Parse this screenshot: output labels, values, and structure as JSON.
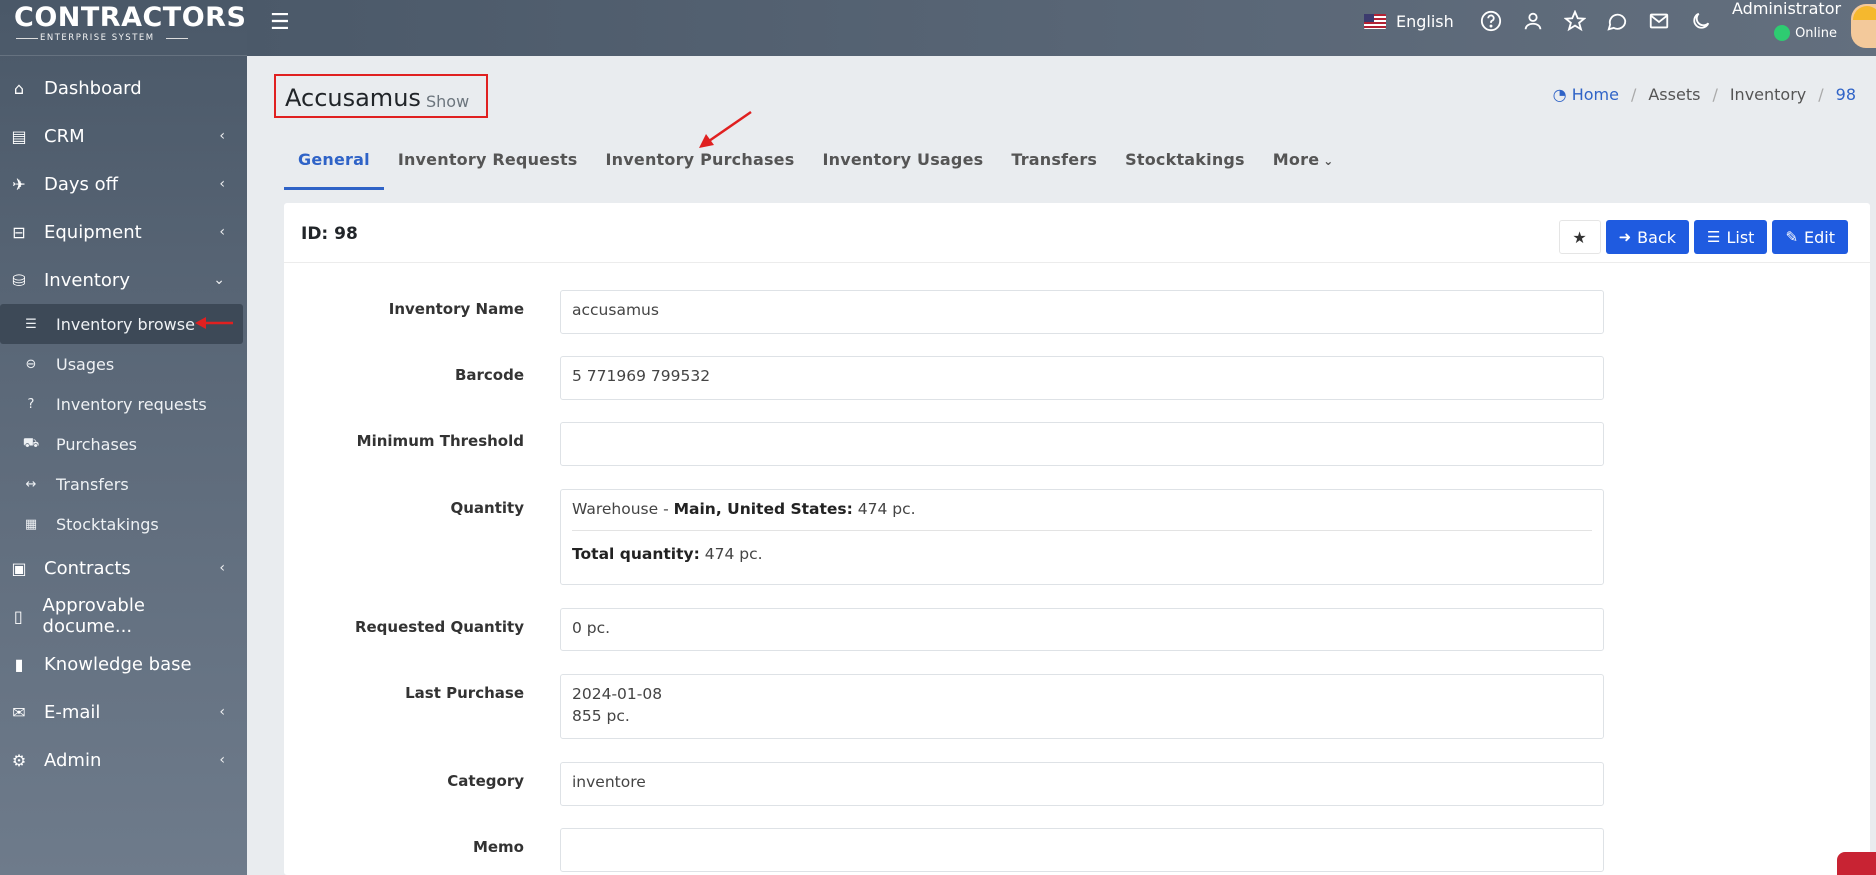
{
  "brand": {
    "title": "CONTRACTORS",
    "subtitle": "ENTERPRISE SYSTEM"
  },
  "sidebar": {
    "items": [
      {
        "label": "Dashboard",
        "icon": "home-icon"
      },
      {
        "label": "CRM",
        "icon": "id-card-icon"
      },
      {
        "label": "Days off",
        "icon": "plane-icon"
      },
      {
        "label": "Equipment",
        "icon": "hdd-icon"
      },
      {
        "label": "Inventory",
        "icon": "boxes-icon"
      },
      {
        "label": "Contracts",
        "icon": "briefcase-icon"
      },
      {
        "label": "Approvable docume...",
        "icon": "file-icon"
      },
      {
        "label": "Knowledge base",
        "icon": "book-icon"
      },
      {
        "label": "E-mail",
        "icon": "envelope-icon"
      },
      {
        "label": "Admin",
        "icon": "cogs-icon"
      }
    ],
    "inventory_sub": [
      {
        "label": "Inventory browse",
        "icon": "list-icon"
      },
      {
        "label": "Usages",
        "icon": "minus-circle-icon"
      },
      {
        "label": "Inventory requests",
        "icon": "question-circle-icon"
      },
      {
        "label": "Purchases",
        "icon": "cart-icon"
      },
      {
        "label": "Transfers",
        "icon": "arrows-h-icon"
      },
      {
        "label": "Stocktakings",
        "icon": "calculator-icon"
      }
    ]
  },
  "topbar": {
    "language": "English",
    "user_name": "Administrator",
    "user_status": "Online"
  },
  "page": {
    "title": "Accusamus",
    "subtitle": "Show",
    "breadcrumb": [
      "Home",
      "Assets",
      "Inventory",
      "98"
    ]
  },
  "tabs": [
    "General",
    "Inventory Requests",
    "Inventory Purchases",
    "Inventory Usages",
    "Transfers",
    "Stocktakings",
    "More"
  ],
  "card": {
    "id_label": "ID: 98",
    "buttons": {
      "back": "Back",
      "list": "List",
      "edit": "Edit"
    }
  },
  "fields": {
    "inventory_name": {
      "label": "Inventory Name",
      "value": "accusamus"
    },
    "barcode": {
      "label": "Barcode",
      "value": "5 771969 799532"
    },
    "minimum_threshold": {
      "label": "Minimum Threshold",
      "value": ""
    },
    "quantity": {
      "label": "Quantity",
      "warehouse_prefix": "Warehouse - ",
      "warehouse_name": "Main, United States:",
      "warehouse_qty": " 474 pc.",
      "total_label": "Total quantity:",
      "total_value": " 474 pc."
    },
    "requested_quantity": {
      "label": "Requested Quantity",
      "value": "0 pc."
    },
    "last_purchase": {
      "label": "Last Purchase",
      "date": "2024-01-08",
      "qty": "855 pc."
    },
    "category": {
      "label": "Category",
      "value": "inventore"
    },
    "memo": {
      "label": "Memo",
      "value": ""
    }
  },
  "colors": {
    "accent": "#2f63c7",
    "button": "#1f5be0",
    "annotation": "#e02020"
  }
}
